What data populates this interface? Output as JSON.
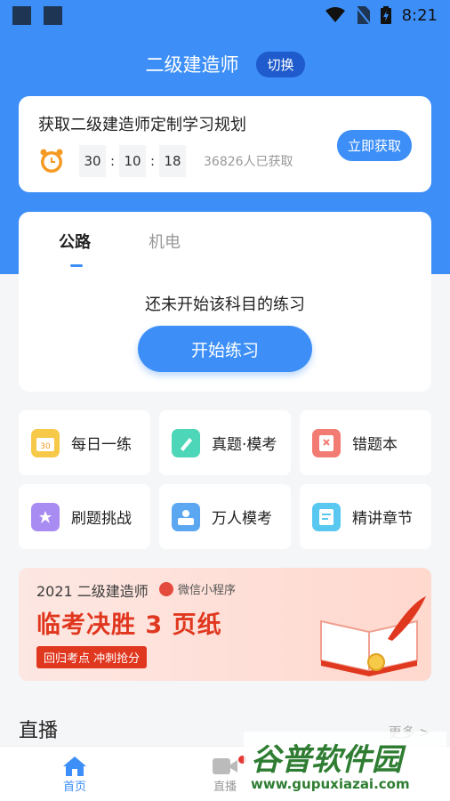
{
  "status_bar": {
    "time": "8:21"
  },
  "header": {
    "title": "二级建造师",
    "switch_label": "切换"
  },
  "plan_card": {
    "title": "获取二级建造师定制学习规划",
    "countdown": [
      "30",
      "10",
      "18"
    ],
    "separator": ":",
    "count_text": "36826人已获取",
    "button_label": "立即获取"
  },
  "practice": {
    "tabs": [
      {
        "label": "公路"
      },
      {
        "label": "机电"
      }
    ],
    "message": "还未开始该科目的练习",
    "start_label": "开始练习"
  },
  "grid": [
    {
      "label": "每日一练",
      "icon": "calendar-icon",
      "color": "#f7c948"
    },
    {
      "label": "真题·模考",
      "icon": "pen-icon",
      "color": "#4dd6b8"
    },
    {
      "label": "错题本",
      "icon": "wrong-book-icon",
      "color": "#f27b73"
    },
    {
      "label": "刷题挑战",
      "icon": "star-badge-icon",
      "color": "#a88cf2"
    },
    {
      "label": "万人模考",
      "icon": "person-card-icon",
      "color": "#5ba7f2"
    },
    {
      "label": "精讲章节",
      "icon": "document-icon",
      "color": "#58c8f0"
    }
  ],
  "banner": {
    "year_title": "2021 二级建造师",
    "wechat_label": "微信小程序",
    "headline": "临考决胜 3 页纸",
    "subline": "回归考点 冲刺抢分"
  },
  "live": {
    "title": "直播",
    "more_label": "更多 >"
  },
  "bottom_nav": [
    {
      "label": "首页",
      "icon": "home-icon"
    },
    {
      "label": "直播",
      "icon": "video-icon"
    }
  ],
  "watermark": {
    "title": "谷普软件园",
    "url": "www.gupuxiazai.com"
  },
  "colors": {
    "accent": "#3d8ff7",
    "banner_red": "#e0371f"
  }
}
